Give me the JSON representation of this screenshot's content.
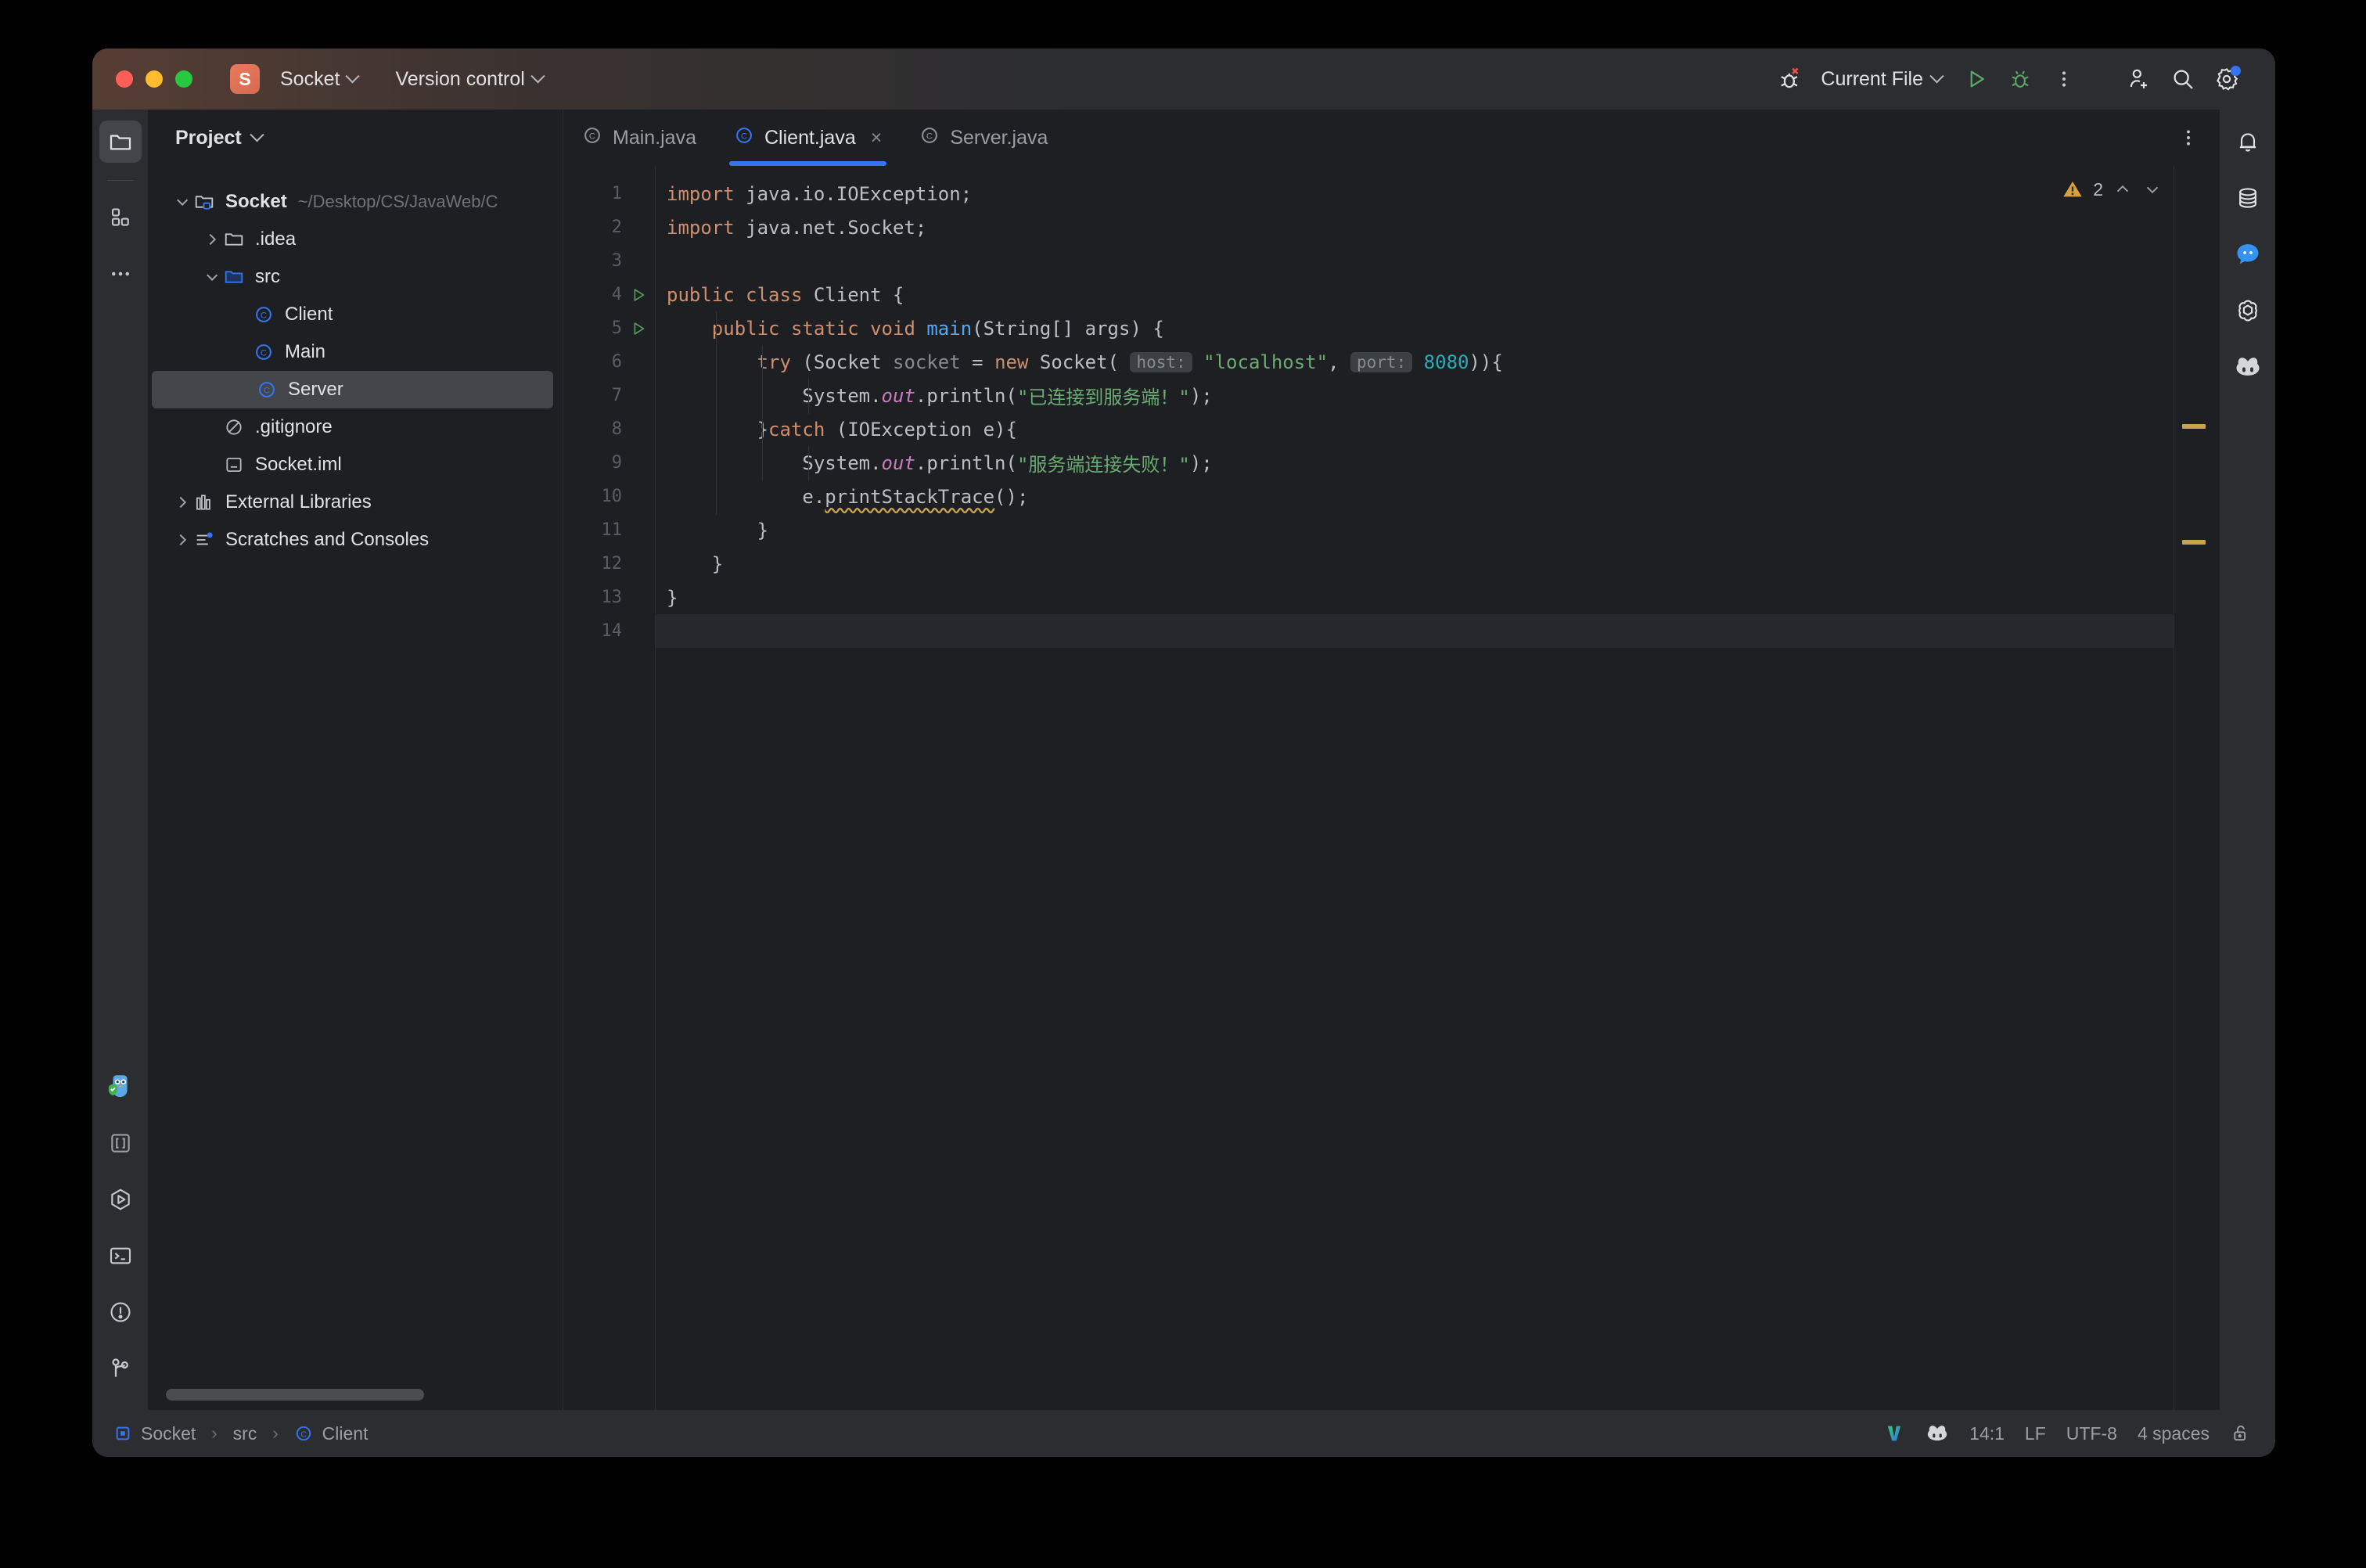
{
  "titlebar": {
    "project_initial": "S",
    "project_name": "Socket",
    "version_control_label": "Version control",
    "run_config_label": "Current File",
    "icons": {
      "debug_x": "debug-disabled-icon",
      "run": "run-icon",
      "debug": "debug-icon",
      "more": "more-vertical-icon",
      "add_user": "add-user-icon",
      "search": "search-icon",
      "settings": "settings-gear-icon"
    }
  },
  "left_toolbar": {
    "items": [
      {
        "name": "project-tool-window",
        "icon": "folder-icon",
        "active": true
      },
      {
        "name": "structure-tool-window",
        "icon": "structure-blocks-icon",
        "active": false
      },
      {
        "name": "more-tool-windows",
        "icon": "more-horizontal-icon",
        "active": false
      }
    ],
    "bottom_items": [
      {
        "name": "ai-assistant-plugin",
        "icon": "owl-shield-icon"
      },
      {
        "name": "brackets-tool",
        "icon": "brackets-icon"
      },
      {
        "name": "run-tool-window",
        "icon": "run-hexagon-icon"
      },
      {
        "name": "terminal-tool-window",
        "icon": "terminal-icon"
      },
      {
        "name": "problems-tool-window",
        "icon": "exclamation-circle-icon"
      },
      {
        "name": "version-control-tool-window",
        "icon": "branch-icon"
      }
    ]
  },
  "project_panel": {
    "title": "Project",
    "tree": [
      {
        "label": "Socket",
        "path": "~/Desktop/CS/JavaWeb/C",
        "icon": "project-folder-icon",
        "arrow": "down",
        "indent": 0,
        "bold": true,
        "selected": false
      },
      {
        "label": ".idea",
        "path": "",
        "icon": "folder-icon",
        "arrow": "right",
        "indent": 1,
        "bold": false,
        "selected": false
      },
      {
        "label": "src",
        "path": "",
        "icon": "source-folder-icon",
        "arrow": "down",
        "indent": 1,
        "bold": false,
        "selected": false
      },
      {
        "label": "Client",
        "path": "",
        "icon": "java-class-icon",
        "arrow": "none",
        "indent": 2,
        "bold": false,
        "selected": false
      },
      {
        "label": "Main",
        "path": "",
        "icon": "java-class-icon",
        "arrow": "none",
        "indent": 2,
        "bold": false,
        "selected": false
      },
      {
        "label": "Server",
        "path": "",
        "icon": "java-class-icon",
        "arrow": "none",
        "indent": 2,
        "bold": false,
        "selected": true
      },
      {
        "label": ".gitignore",
        "path": "",
        "icon": "gitignore-icon",
        "arrow": "none",
        "indent": 1,
        "bold": false,
        "selected": false
      },
      {
        "label": "Socket.iml",
        "path": "",
        "icon": "iml-file-icon",
        "arrow": "none",
        "indent": 1,
        "bold": false,
        "selected": false
      },
      {
        "label": "External Libraries",
        "path": "",
        "icon": "libraries-icon",
        "arrow": "right",
        "indent": 0,
        "bold": false,
        "selected": false
      },
      {
        "label": "Scratches and Consoles",
        "path": "",
        "icon": "scratches-icon",
        "arrow": "right",
        "indent": 0,
        "bold": false,
        "selected": false
      }
    ]
  },
  "editor": {
    "tabs": [
      {
        "label": "Main.java",
        "icon": "java-class-icon",
        "active": false,
        "closable": false
      },
      {
        "label": "Client.java",
        "icon": "java-class-icon",
        "active": true,
        "closable": true
      },
      {
        "label": "Server.java",
        "icon": "java-class-icon",
        "active": false,
        "closable": false
      }
    ],
    "tab_more_icon": "more-vertical-icon",
    "warning_count": "2",
    "warning_icon": "warning-triangle-icon",
    "nav_up_icon": "chevron-up-icon",
    "nav_down_icon": "chevron-down-icon",
    "line_numbers": [
      "1",
      "2",
      "3",
      "4",
      "5",
      "6",
      "7",
      "8",
      "9",
      "10",
      "11",
      "12",
      "13",
      "14"
    ],
    "gutter_run_lines": [
      "4",
      "5"
    ],
    "current_line": "14",
    "code_lines": [
      {
        "n": 1,
        "tokens": [
          {
            "t": "import",
            "c": "kw"
          },
          {
            "t": " java.io.IOException;",
            "c": ""
          }
        ]
      },
      {
        "n": 2,
        "tokens": [
          {
            "t": "import",
            "c": "kw"
          },
          {
            "t": " java.net.Socket;",
            "c": ""
          }
        ]
      },
      {
        "n": 3,
        "tokens": []
      },
      {
        "n": 4,
        "tokens": [
          {
            "t": "public",
            "c": "kw"
          },
          {
            "t": " ",
            "c": ""
          },
          {
            "t": "class",
            "c": "kw"
          },
          {
            "t": " Client {",
            "c": ""
          }
        ]
      },
      {
        "n": 5,
        "tokens": [
          {
            "t": "    ",
            "c": ""
          },
          {
            "t": "public",
            "c": "kw"
          },
          {
            "t": " ",
            "c": ""
          },
          {
            "t": "static",
            "c": "kw"
          },
          {
            "t": " ",
            "c": ""
          },
          {
            "t": "void",
            "c": "kw"
          },
          {
            "t": " ",
            "c": ""
          },
          {
            "t": "main",
            "c": "fn"
          },
          {
            "t": "(String[] args) {",
            "c": ""
          }
        ]
      },
      {
        "n": 6,
        "tokens": [
          {
            "t": "        ",
            "c": ""
          },
          {
            "t": "try",
            "c": "kw"
          },
          {
            "t": " (Socket ",
            "c": ""
          },
          {
            "t": "socket",
            "c": "var"
          },
          {
            "t": " = ",
            "c": ""
          },
          {
            "t": "new",
            "c": "kw"
          },
          {
            "t": " Socket( ",
            "c": ""
          },
          {
            "t": "host:",
            "c": "hint"
          },
          {
            "t": " ",
            "c": ""
          },
          {
            "t": "\"localhost\"",
            "c": "str"
          },
          {
            "t": ", ",
            "c": ""
          },
          {
            "t": "port:",
            "c": "hint"
          },
          {
            "t": " ",
            "c": ""
          },
          {
            "t": "8080",
            "c": "num"
          },
          {
            "t": ")){",
            "c": ""
          }
        ]
      },
      {
        "n": 7,
        "tokens": [
          {
            "t": "            System.",
            "c": ""
          },
          {
            "t": "out",
            "c": "fld"
          },
          {
            "t": ".println(",
            "c": ""
          },
          {
            "t": "\"已连接到服务端！\"",
            "c": "str"
          },
          {
            "t": ");",
            "c": ""
          }
        ]
      },
      {
        "n": 8,
        "tokens": [
          {
            "t": "        }",
            "c": ""
          },
          {
            "t": "catch",
            "c": "kw"
          },
          {
            "t": " (IOException e){",
            "c": ""
          }
        ]
      },
      {
        "n": 9,
        "tokens": [
          {
            "t": "            System.",
            "c": ""
          },
          {
            "t": "out",
            "c": "fld"
          },
          {
            "t": ".println(",
            "c": ""
          },
          {
            "t": "\"服务端连接失败！\"",
            "c": "str"
          },
          {
            "t": ");",
            "c": ""
          }
        ]
      },
      {
        "n": 10,
        "tokens": [
          {
            "t": "            e.",
            "c": ""
          },
          {
            "t": "printStackTrace",
            "c": "warn"
          },
          {
            "t": "();",
            "c": ""
          }
        ]
      },
      {
        "n": 11,
        "tokens": [
          {
            "t": "        }",
            "c": ""
          }
        ]
      },
      {
        "n": 12,
        "tokens": [
          {
            "t": "    }",
            "c": ""
          }
        ]
      },
      {
        "n": 13,
        "tokens": [
          {
            "t": "}",
            "c": ""
          }
        ]
      },
      {
        "n": 14,
        "tokens": []
      }
    ]
  },
  "right_toolbar": {
    "items": [
      {
        "name": "notifications",
        "icon": "bell-icon"
      },
      {
        "name": "database-tool-window",
        "icon": "database-icon"
      },
      {
        "name": "ai-chat",
        "icon": "chat-bubble-icon"
      },
      {
        "name": "openai-plugin",
        "icon": "openai-icon"
      },
      {
        "name": "copilot-plugin",
        "icon": "copilot-icon"
      }
    ]
  },
  "statusbar": {
    "breadcrumb": [
      {
        "label": "Socket",
        "icon": "module-icon"
      },
      {
        "label": "src",
        "icon": "none"
      },
      {
        "label": "Client",
        "icon": "java-class-icon"
      }
    ],
    "right": {
      "vcs_icon": "v-logo-icon",
      "copilot_icon": "copilot-icon",
      "caret_position": "14:1",
      "line_separator": "LF",
      "encoding": "UTF-8",
      "indent": "4 spaces",
      "lock_icon": "unlocked-padlock-icon"
    }
  },
  "colors": {
    "accent_blue": "#3574f0",
    "keyword": "#cf8e6d",
    "string": "#6aab73",
    "number": "#2aacb8",
    "warning": "#c9a34e",
    "bg": "#1e1f22",
    "panel": "#2b2d30"
  }
}
